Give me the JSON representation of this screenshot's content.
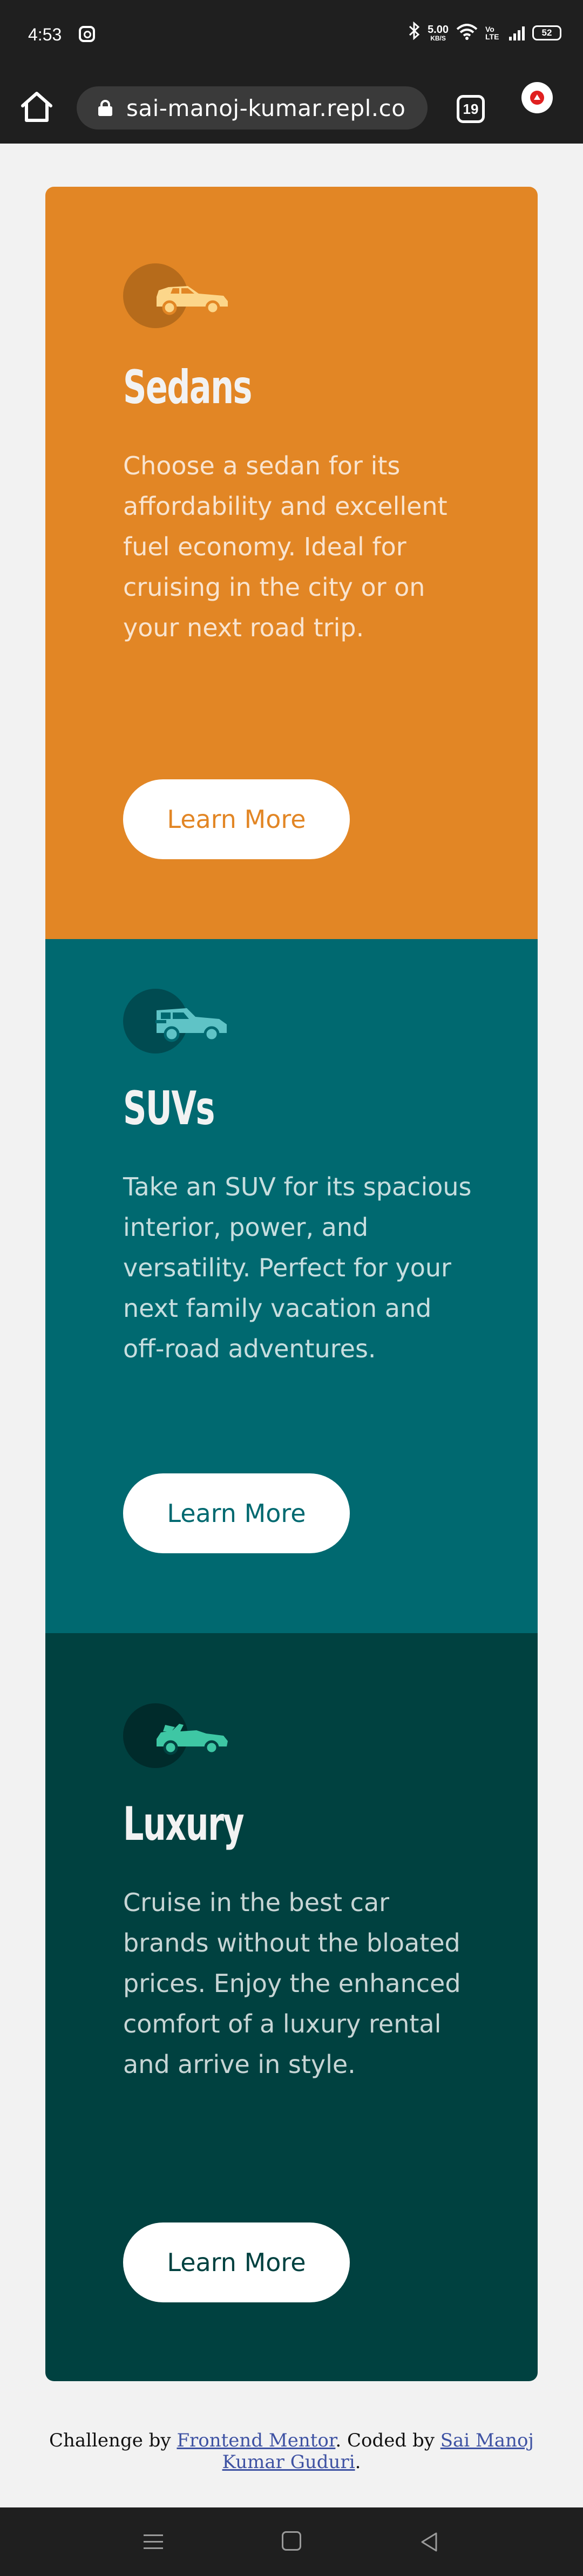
{
  "status_bar": {
    "time": "4:53",
    "net_speed": "5.00",
    "net_speed_unit": "KB/S",
    "volte_label": "Vo LTE",
    "battery": "52",
    "icons": [
      "instagram-icon",
      "bluetooth-icon",
      "wifi-icon",
      "signal-icon",
      "battery-icon"
    ]
  },
  "browser": {
    "url": "sai-manoj-kumar.repl.co",
    "tab_count": "19",
    "icons": [
      "home-icon",
      "lock-icon",
      "tabs-icon",
      "extension-icon"
    ]
  },
  "cards": [
    {
      "title": "Sedans",
      "description": "Choose a sedan for its affordability and excellent fuel economy. Ideal for cruising in the city or on your next road trip.",
      "button": "Learn More",
      "icon": "sedan-icon",
      "color": "#e28625"
    },
    {
      "title": "SUVs",
      "description": "Take an SUV for its spacious interior, power, and versatility. Perfect for your next family vacation and off-road adventures.",
      "button": "Learn More",
      "icon": "suv-icon",
      "color": "#006970"
    },
    {
      "title": "Luxury",
      "description": "Cruise in the best car brands without the bloated prices. Enjoy the enhanced comfort of a luxury rental and arrive in style.",
      "button": "Learn More",
      "icon": "luxury-car-icon",
      "color": "#004140"
    }
  ],
  "footer": {
    "prefix": "Challenge by",
    "link1": "Frontend Mentor",
    "middle": ". Coded by",
    "link2": "Sai Manoj Kumar Guduri",
    "suffix": "."
  },
  "nav_bar": {
    "icons": [
      "menu-icon",
      "home-square-icon",
      "back-icon"
    ]
  }
}
